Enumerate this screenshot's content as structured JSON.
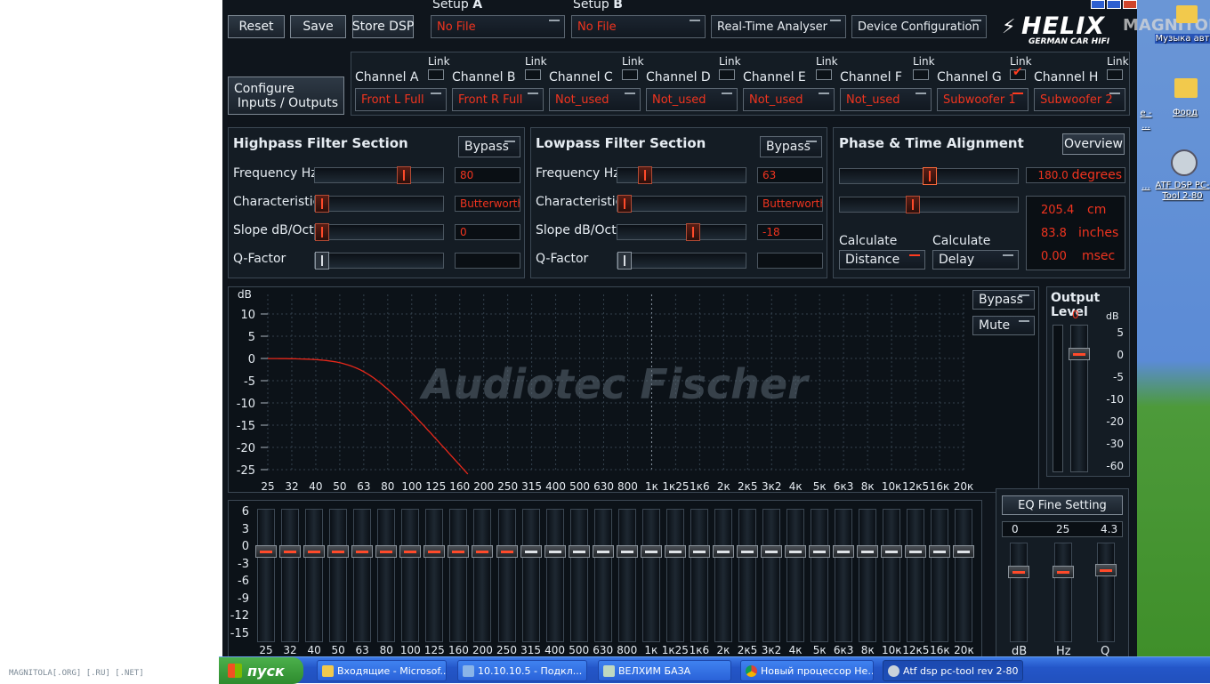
{
  "top": {
    "reset": "Reset",
    "save": "Save",
    "store": "Store DSP",
    "setup_prefix": "Setup",
    "setup_a": "A",
    "setup_b": "B",
    "setup_a_value": "No File",
    "setup_b_value": "No File",
    "rta": "Real-Time Analyser",
    "device": "Device Configuration"
  },
  "logo": {
    "brand": "HELIX",
    "sub": "GERMAN CAR HIFI"
  },
  "io": {
    "button_line1": "Configure",
    "button_line2": "Inputs / Outputs",
    "link": "Link"
  },
  "channels": [
    {
      "name": "Channel A",
      "value": "Front L Full",
      "linked": false
    },
    {
      "name": "Channel B",
      "value": "Front R Full",
      "linked": false
    },
    {
      "name": "Channel C",
      "value": "Not_used",
      "linked": false
    },
    {
      "name": "Channel D",
      "value": "Not_used",
      "linked": false
    },
    {
      "name": "Channel E",
      "value": "Not_used",
      "linked": false
    },
    {
      "name": "Channel F",
      "value": "Not_used",
      "linked": false
    },
    {
      "name": "Channel G",
      "value": "Subwoofer 1",
      "linked": true
    },
    {
      "name": "Channel H",
      "value": "Subwoofer 2",
      "linked": false
    }
  ],
  "highpass": {
    "title": "Highpass Filter Section",
    "bypass": "Bypass",
    "rows": [
      {
        "label": "Frequency Hz",
        "value": "80",
        "pos": 0.72
      },
      {
        "label": "Characteristic",
        "value": "Butterworth",
        "pos": 0.0
      },
      {
        "label": "Slope dB/Oct",
        "value": "0",
        "pos": 0.0
      },
      {
        "label": "Q-Factor",
        "value": "",
        "pos": 0.0
      }
    ]
  },
  "lowpass": {
    "title": "Lowpass Filter Section",
    "bypass": "Bypass",
    "rows": [
      {
        "label": "Frequency Hz",
        "value": "63",
        "pos": 0.18
      },
      {
        "label": "Characteristic",
        "value": "Butterworth",
        "pos": 0.0
      },
      {
        "label": "Slope dB/Oct",
        "value": "-18",
        "pos": 0.6
      },
      {
        "label": "Q-Factor",
        "value": "",
        "pos": 0.0
      }
    ]
  },
  "phase": {
    "title": "Phase & Time Alignment",
    "overview": "Overview",
    "phase_value": "180.0",
    "phase_unit": "degrees",
    "phase_pos": 0.5,
    "time_pos": 0.4,
    "cm": "205.4",
    "cm_unit": "cm",
    "inches": "83.8",
    "inches_unit": "inches",
    "msec": "0.00",
    "msec_unit": "msec",
    "calc1": "Calculate",
    "calc2": "Calculate",
    "distance": "Distance",
    "delay": "Delay"
  },
  "graph": {
    "ylabel": "dB",
    "watermark": "Audiotec Fischer",
    "bypass": "Bypass",
    "mute": "Mute",
    "yticks": [
      "10",
      "5",
      "0",
      "-5",
      "-10",
      "-15",
      "-20",
      "-25"
    ],
    "xticks": [
      "25",
      "32",
      "40",
      "50",
      "63",
      "80",
      "100",
      "125",
      "160",
      "200",
      "250",
      "315",
      "400",
      "500",
      "630",
      "800",
      "1к",
      "1к25",
      "1к6",
      "2к",
      "2к5",
      "3к2",
      "4к",
      "5к",
      "6к3",
      "8к",
      "10к",
      "12к5",
      "16к",
      "20к"
    ]
  },
  "output": {
    "title": "Output Level",
    "value": "0",
    "unit": "dB",
    "ticks": [
      "5",
      "0",
      "-5",
      "-10",
      "-20",
      "-30",
      "-60"
    ],
    "level_db": 0
  },
  "eq": {
    "yticks": [
      "6",
      "3",
      "0",
      "-3",
      "-6",
      "-9",
      "-12",
      "-15"
    ],
    "active_bands": 11,
    "gains_db": [
      0,
      0,
      0,
      0,
      0,
      0,
      0,
      0,
      0,
      0,
      0,
      0,
      0,
      0,
      0,
      0,
      0,
      0,
      0,
      0,
      0,
      0,
      0,
      0,
      0,
      0,
      0,
      0,
      0,
      0
    ]
  },
  "fine": {
    "title": "EQ Fine Setting",
    "db": "0",
    "hz": "25",
    "q": "4.3",
    "db_label": "dB",
    "hz_label": "Hz",
    "q_label": "Q"
  },
  "taskbar": {
    "start": "пуск",
    "items": [
      "Входящие - Microsof...",
      "10.10.10.5 - Подкл...",
      "ВЕЛХИМ БАЗА",
      "Новый процессор Не...",
      "Atf dsp pc-tool rev 2-80"
    ]
  },
  "desktop": {
    "icons": [
      "Музыка авт",
      "Форд",
      "ATF DSP PC-Tool 2-80"
    ],
    "partial1": "е -",
    "partial2": "...",
    "watermark": "MAGNITOLA"
  },
  "footer": "MAGNITOLA[.ORG] [.RU] [.NET]",
  "colors": {
    "accent": "#f0341f",
    "bg": "#0f151c"
  }
}
